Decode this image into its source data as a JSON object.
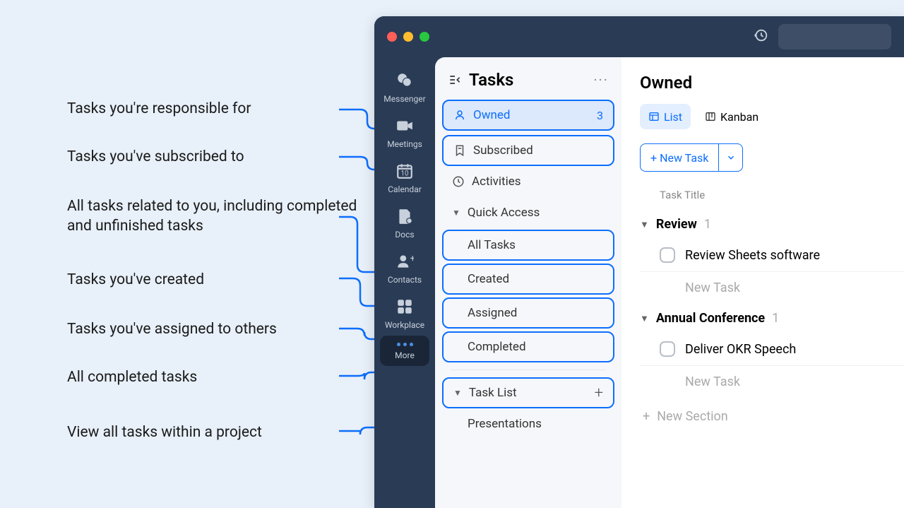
{
  "annotations": {
    "owned": "Tasks you're responsible for",
    "subscribed": "Tasks you've subscribed to",
    "all_tasks": "All tasks related to you, including completed and unfinished tasks",
    "created": "Tasks you've created",
    "assigned": "Tasks you've assigned to others",
    "completed": "All completed tasks",
    "task_list": "View all tasks within a project"
  },
  "rail": {
    "messenger": "Messenger",
    "meetings": "Meetings",
    "calendar": "Calendar",
    "calendar_day": "10",
    "docs": "Docs",
    "contacts": "Contacts",
    "workplace": "Workplace",
    "more": "More"
  },
  "tasks_sidebar": {
    "title": "Tasks",
    "owned": {
      "label": "Owned",
      "count": "3"
    },
    "subscribed": {
      "label": "Subscribed"
    },
    "activities": {
      "label": "Activities"
    },
    "quick_access_header": "Quick Access",
    "qa": {
      "all_tasks": "All Tasks",
      "created": "Created",
      "assigned": "Assigned",
      "completed": "Completed"
    },
    "task_list_header": "Task List",
    "task_lists": {
      "presentations": "Presentations"
    }
  },
  "main": {
    "title": "Owned",
    "tabs": {
      "list": "List",
      "kanban": "Kanban"
    },
    "new_task": "New Task",
    "col_title": "Task Title",
    "sections": {
      "review": {
        "name": "Review",
        "count": "1",
        "task1": "Review Sheets software"
      },
      "conf": {
        "name": "Annual Conference",
        "count": "1",
        "task1": "Deliver OKR Speech"
      }
    },
    "new_task_ghost": "New Task",
    "new_section": "New Section"
  }
}
